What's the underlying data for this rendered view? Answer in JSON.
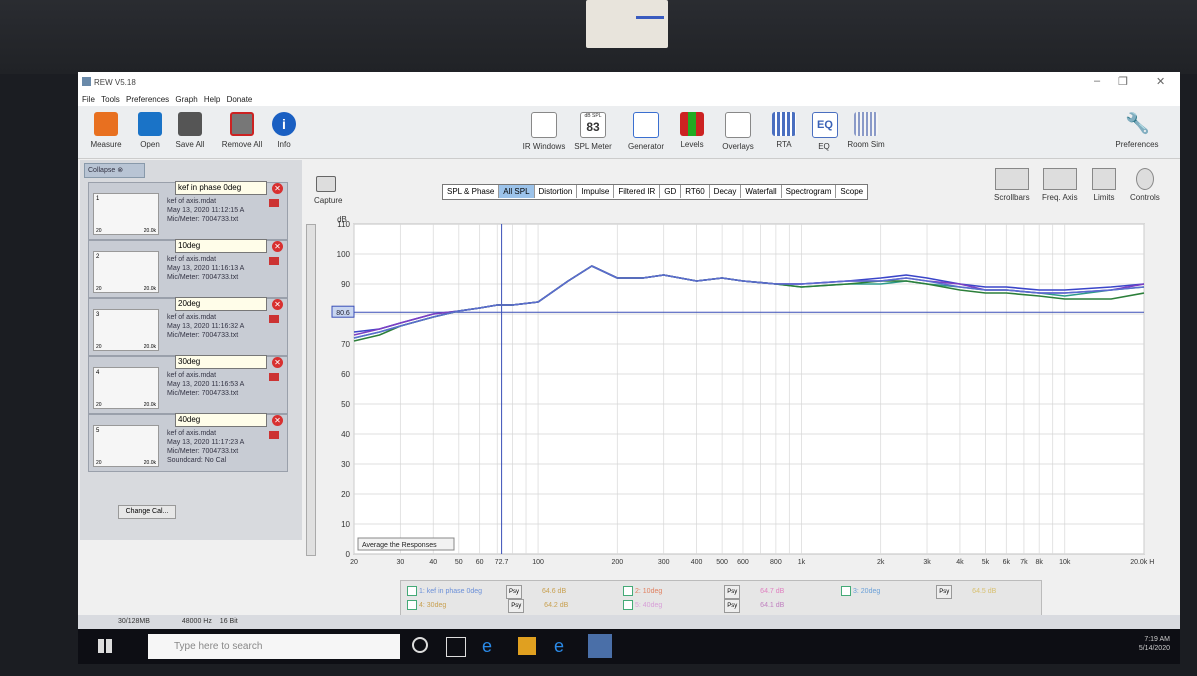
{
  "window": {
    "title": "REW V5.18"
  },
  "menu": [
    "File",
    "Tools",
    "Preferences",
    "Graph",
    "Help",
    "Donate"
  ],
  "toolbar_left": [
    {
      "label": "Measure",
      "icon": "measure-icon",
      "color": "#e87020"
    },
    {
      "label": "Open",
      "icon": "folder-open-icon",
      "color": "#1a73c7"
    },
    {
      "label": "Save All",
      "icon": "save-all-icon",
      "color": "#333333"
    },
    {
      "label": "Remove All",
      "icon": "remove-all-icon",
      "color": "#c22222"
    },
    {
      "label": "Info",
      "icon": "info-icon",
      "color": "#1a5fc2"
    }
  ],
  "toolbar_center": [
    {
      "label": "IR Windows",
      "icon": "ir-windows-icon"
    },
    {
      "label": "SPL Meter",
      "icon": "spl-meter-icon",
      "badge_top": "dB SPL",
      "badge_value": "83"
    },
    {
      "label": "Generator",
      "icon": "generator-icon"
    },
    {
      "label": "Levels",
      "icon": "levels-icon"
    },
    {
      "label": "Overlays",
      "icon": "overlays-icon"
    },
    {
      "label": "RTA",
      "icon": "rta-icon"
    },
    {
      "label": "EQ",
      "icon": "eq-icon"
    },
    {
      "label": "Room Sim",
      "icon": "room-sim-icon"
    }
  ],
  "toolbar_right": {
    "label": "Preferences",
    "icon": "wrench-icon"
  },
  "left_panel": {
    "collapse_label": "Collapse",
    "measurements": [
      {
        "index": "1",
        "name": "kef in phase 0deg",
        "file": "kef of axis.mdat",
        "date": "May 13, 2020 11:12:15 A",
        "device": "Mic/Meter: 7004733.txt",
        "thumb_lo": "20",
        "thumb_hi": "20.0k"
      },
      {
        "index": "2",
        "name": "10deg",
        "file": "kef of axis.mdat",
        "date": "May 13, 2020 11:16:13 A",
        "device": "Mic/Meter: 7004733.txt",
        "thumb_lo": "20",
        "thumb_hi": "20.0k"
      },
      {
        "index": "3",
        "name": "20deg",
        "file": "kef of axis.mdat",
        "date": "May 13, 2020 11:16:32 A",
        "device": "Mic/Meter: 7004733.txt",
        "thumb_lo": "20",
        "thumb_hi": "20.0k"
      },
      {
        "index": "4",
        "name": "30deg",
        "file": "kef of axis.mdat",
        "date": "May 13, 2020 11:16:53 A",
        "device": "Mic/Meter: 7004733.txt",
        "thumb_lo": "20",
        "thumb_hi": "20.0k"
      },
      {
        "index": "5",
        "name": "40deg",
        "file": "kef of axis.mdat",
        "date": "May 13, 2020 11:17:23 A",
        "device": "Mic/Meter: 7004733.txt",
        "extra": "Soundcard: No Cal",
        "thumb_lo": "20",
        "thumb_hi": "20.0k"
      }
    ],
    "change_cal_label": "Change Cal..."
  },
  "capture": {
    "label": "Capture"
  },
  "tabs": [
    "SPL & Phase",
    "All SPL",
    "Distortion",
    "Impulse",
    "Filtered IR",
    "GD",
    "RT60",
    "Decay",
    "Waterfall",
    "Spectrogram",
    "Scope"
  ],
  "active_tab": "All SPL",
  "graph_controls": [
    {
      "label": "Scrollbars",
      "icon": "scrollbars-icon"
    },
    {
      "label": "Freq. Axis",
      "icon": "freq-axis-icon"
    },
    {
      "label": "Limits",
      "icon": "limits-icon"
    },
    {
      "label": "Controls",
      "icon": "controls-icon"
    }
  ],
  "graph": {
    "average_button": "Average the Responses",
    "cursor_y_label": "80.6",
    "cursor_x_label": "72.7"
  },
  "chart_data": {
    "type": "line",
    "title": "",
    "ylabel": "dB",
    "xlabel": "",
    "x_scale": "log",
    "xlim": [
      20,
      20000
    ],
    "ylim": [
      0,
      110
    ],
    "y_ticks": [
      0,
      10,
      20,
      30,
      40,
      50,
      60,
      70,
      80,
      90,
      100,
      110
    ],
    "x_ticks": [
      "20",
      "30",
      "40",
      "50",
      "60",
      "72.7",
      "100",
      "200",
      "300",
      "400",
      "500",
      "600",
      "800",
      "1k",
      "2k",
      "3k",
      "4k",
      "5k",
      "6k",
      "7k",
      "8k",
      "10k",
      "20.0k Hz"
    ],
    "grid": true,
    "cursor": {
      "x": 72.7,
      "y": 80.6
    },
    "x": [
      20,
      25,
      30,
      40,
      50,
      60,
      70,
      80,
      100,
      130,
      160,
      200,
      250,
      300,
      400,
      500,
      600,
      800,
      1000,
      1500,
      2000,
      2500,
      3000,
      4000,
      5000,
      6000,
      8000,
      10000,
      15000,
      20000
    ],
    "series": [
      {
        "name": "kef in phase 0deg",
        "color": "#2e9b8a",
        "values": [
          72,
          74,
          76,
          79,
          81,
          82,
          83,
          83,
          84,
          91,
          96,
          92,
          92,
          93,
          91,
          92,
          91,
          90,
          89,
          90,
          90,
          91,
          90,
          89,
          88,
          88,
          87,
          86,
          88,
          89
        ]
      },
      {
        "name": "10deg",
        "color": "#3a45c9",
        "values": [
          74,
          75,
          77,
          80,
          81,
          82,
          83,
          83,
          84,
          91,
          96,
          92,
          92,
          93,
          91,
          92,
          91,
          90,
          90,
          91,
          92,
          93,
          92,
          90,
          89,
          89,
          88,
          88,
          89,
          90
        ]
      },
      {
        "name": "20deg",
        "color": "#7c3fc2",
        "values": [
          73,
          75,
          77,
          80,
          81,
          82,
          83,
          83,
          84,
          91,
          96,
          92,
          92,
          93,
          91,
          92,
          91,
          90,
          90,
          91,
          91,
          92,
          91,
          90,
          88,
          88,
          87,
          87,
          88,
          90
        ]
      },
      {
        "name": "30deg",
        "color": "#2c7f3a",
        "values": [
          71,
          73,
          76,
          79,
          81,
          82,
          83,
          83,
          84,
          91,
          96,
          92,
          92,
          93,
          91,
          92,
          91,
          90,
          89,
          90,
          91,
          91,
          90,
          88,
          87,
          87,
          86,
          85,
          85,
          87
        ]
      },
      {
        "name": "40deg",
        "color": "#5b6cd0",
        "values": [
          72,
          74,
          76,
          79,
          81,
          82,
          83,
          83,
          84,
          91,
          96,
          92,
          92,
          93,
          91,
          92,
          91,
          90,
          90,
          91,
          91,
          92,
          91,
          89,
          88,
          88,
          87,
          87,
          88,
          89
        ]
      }
    ]
  },
  "legend": [
    {
      "label": "1: kef in phase 0deg",
      "psy": "Psy",
      "value": "64.6 dB",
      "color": "#2e9b8a"
    },
    {
      "label": "2: 10deg",
      "psy": "Psy",
      "value": "64.7 dB",
      "color": "#3a45c9"
    },
    {
      "label": "3: 20deg",
      "psy": "Psy",
      "value": "64.5 dB",
      "color": "#7c3fc2"
    },
    {
      "label": "4: 30deg",
      "psy": "Psy",
      "value": "64.2 dB",
      "color": "#2c7f3a"
    },
    {
      "label": "5: 40deg",
      "psy": "Psy",
      "value": "64.1 dB",
      "color": "#5b6cd0"
    }
  ],
  "status": {
    "mem": "30/128MB",
    "rate": "48000 Hz",
    "bits": "16 Bit"
  },
  "taskbar": {
    "search_placeholder": "Type here to search",
    "time": "7:19 AM",
    "date": "5/14/2020"
  }
}
